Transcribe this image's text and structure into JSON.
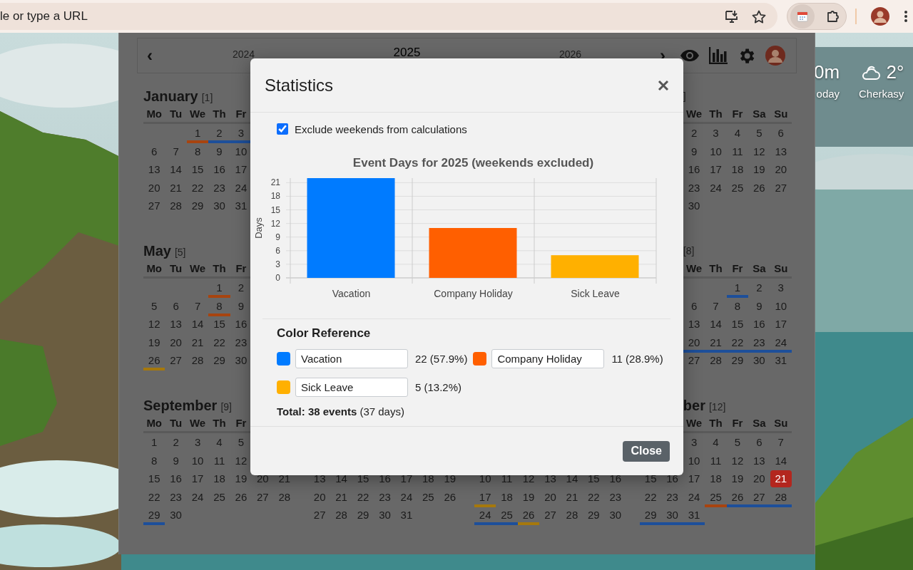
{
  "browser": {
    "address_placeholder": "le or type a URL"
  },
  "weather": {
    "time_fragment": "0m",
    "time_caption": "oday",
    "temperature": "2°",
    "city": "Cherkasy"
  },
  "calendar": {
    "prev": "‹",
    "next": "›",
    "years": [
      {
        "label": "2024",
        "selected": false
      },
      {
        "label": "2025",
        "selected": true
      },
      {
        "label": "2026",
        "selected": false
      }
    ],
    "month_rows": [
      [
        {
          "name": "January",
          "number": "[1]",
          "weekdays": [
            "Mo",
            "Tu",
            "We",
            "Th",
            "Fr"
          ],
          "weeks": [
            [
              {
                "kind": "blank"
              },
              {
                "kind": "blank"
              },
              {
                "kind": "event",
                "day": "1",
                "color": "#a8440f"
              },
              {
                "kind": "event",
                "day": "2",
                "color": "#1d4f9a"
              },
              {
                "kind": "event",
                "day": "3",
                "color": "#1d4f9a"
              }
            ],
            [
              "6",
              "7",
              "8",
              "9",
              "10"
            ],
            [
              "13",
              "14",
              "15",
              "16",
              "17"
            ],
            [
              "20",
              "21",
              "22",
              "23",
              "24"
            ],
            [
              "27",
              "28",
              "29",
              "30",
              "31"
            ]
          ]
        },
        {
          "number": "]",
          "weekdays": [
            {
              "kind": "blank"
            },
            {
              "kind": "blank"
            },
            "We",
            "Th",
            "Fr",
            "Sa",
            "Su"
          ],
          "weeks": [
            [
              {
                "kind": "blank"
              },
              {
                "kind": "blank"
              },
              "2",
              "3",
              "4",
              "5",
              "6"
            ],
            [
              {
                "kind": "blank"
              },
              {
                "kind": "blank"
              },
              "9",
              "10",
              "11",
              "12",
              "13"
            ],
            [
              {
                "kind": "blank"
              },
              {
                "kind": "blank"
              },
              "16",
              "17",
              "18",
              "19",
              "20"
            ],
            [
              {
                "kind": "blank"
              },
              {
                "kind": "blank"
              },
              "23",
              "24",
              "25",
              "26",
              "27"
            ],
            [
              {
                "kind": "blank"
              },
              {
                "kind": "blank"
              },
              "30"
            ]
          ]
        }
      ],
      [
        {
          "name": "May",
          "number": "[5]",
          "weekdays": [
            "Mo",
            "Tu",
            "We",
            "Th",
            "Fr"
          ],
          "weeks": [
            [
              {
                "kind": "blank"
              },
              {
                "kind": "blank"
              },
              {
                "kind": "blank"
              },
              {
                "kind": "event",
                "day": "1",
                "color": "#a8440f"
              },
              "2"
            ],
            [
              "5",
              "6",
              "7",
              {
                "kind": "event",
                "day": "8",
                "color": "#a8440f"
              },
              "9"
            ],
            [
              "12",
              "13",
              "14",
              "15",
              "16"
            ],
            [
              "19",
              "20",
              "21",
              "22",
              "23"
            ],
            [
              {
                "kind": "event",
                "day": "26",
                "color": "#a6780c"
              },
              "27",
              "28",
              "29",
              "30"
            ]
          ]
        },
        {
          "number": "[8]",
          "weekdays": [
            {
              "kind": "blank"
            },
            {
              "kind": "blank"
            },
            "We",
            "Th",
            "Fr",
            "Sa",
            "Su"
          ],
          "weeks": [
            [
              {
                "kind": "blank"
              },
              {
                "kind": "blank"
              },
              {
                "kind": "blank"
              },
              {
                "kind": "blank"
              },
              {
                "kind": "event",
                "day": "1",
                "color": "#1d4f9a"
              },
              "2",
              "3"
            ],
            [
              {
                "kind": "blank"
              },
              {
                "kind": "blank"
              },
              "6",
              "7",
              "8",
              "9",
              "10"
            ],
            [
              {
                "kind": "blank"
              },
              {
                "kind": "blank"
              },
              "13",
              "14",
              "15",
              "16",
              "17"
            ],
            [
              {
                "kind": "blank"
              },
              {
                "kind": "blank"
              },
              {
                "kind": "event",
                "day": "20",
                "color": "#1d4f9a"
              },
              {
                "kind": "event",
                "day": "21",
                "color": "#1d4f9a"
              },
              {
                "kind": "event",
                "day": "22",
                "color": "#1d4f9a"
              },
              {
                "kind": "event",
                "day": "23",
                "color": "#1d4f9a"
              },
              {
                "kind": "event",
                "day": "24",
                "color": "#1d4f9a"
              }
            ],
            [
              {
                "kind": "blank"
              },
              {
                "kind": "blank"
              },
              "27",
              "28",
              "29",
              "30",
              "31"
            ]
          ]
        }
      ],
      [
        {
          "name": "September",
          "number": "[9]",
          "weekdays": [
            "Mo",
            "Tu",
            "We",
            "Th",
            "Fr"
          ],
          "weeks": [
            [
              "1",
              "2",
              "3",
              "4",
              "5"
            ],
            [
              "8",
              "9",
              "10",
              "11",
              "12"
            ],
            [
              "15",
              "16",
              "17",
              "18",
              "19",
              "20",
              "21"
            ],
            [
              "22",
              "23",
              "24",
              "25",
              "26",
              "27",
              "28"
            ],
            [
              {
                "kind": "event",
                "day": "29",
                "color": "#1d4f9a"
              },
              "30"
            ]
          ]
        },
        {
          "weeks": [
            [
              "13",
              "14",
              "15",
              "16",
              "17",
              "18",
              "19"
            ],
            [
              "20",
              "21",
              "22",
              "23",
              "24",
              "25",
              "26"
            ],
            [
              "27",
              "28",
              "29",
              "30",
              "31"
            ]
          ]
        },
        {
          "weeks": [
            [
              "10",
              "11",
              "12",
              "13",
              "14",
              "15",
              "16"
            ],
            [
              {
                "kind": "event",
                "day": "17",
                "color": "#a6780c"
              },
              "18",
              "19",
              "20",
              "21",
              "22",
              "23"
            ],
            [
              {
                "kind": "event",
                "day": "24",
                "color": "#1d4f9a"
              },
              {
                "kind": "event",
                "day": "25",
                "color": "#1d4f9a"
              },
              {
                "kind": "event",
                "day": "26",
                "color": "#a6780c"
              },
              "27",
              "28",
              "29",
              "30"
            ]
          ]
        },
        {
          "name": "ber",
          "number": "[12]",
          "weekdays": [
            {
              "kind": "blank"
            },
            {
              "kind": "blank"
            },
            "We",
            "Th",
            "Fr",
            "Sa",
            "Su"
          ],
          "weeks": [
            [
              {
                "kind": "blank"
              },
              {
                "kind": "blank"
              },
              "3",
              "4",
              "5",
              "6",
              "7"
            ],
            [
              {
                "kind": "blank"
              },
              {
                "kind": "blank"
              },
              "10",
              "11",
              "12",
              "13",
              "14"
            ],
            [
              "15",
              "16",
              "17",
              "18",
              "19",
              "20",
              {
                "kind": "today",
                "day": "21"
              }
            ],
            [
              "22",
              "23",
              "24",
              {
                "kind": "event",
                "day": "25",
                "color": "#a8440f"
              },
              {
                "kind": "event",
                "day": "26",
                "color": "#1d4f9a"
              },
              {
                "kind": "event",
                "day": "27",
                "color": "#1d4f9a"
              },
              {
                "kind": "event",
                "day": "28",
                "color": "#1d4f9a"
              }
            ],
            [
              {
                "kind": "event",
                "day": "29",
                "color": "#1d4f9a"
              },
              {
                "kind": "event",
                "day": "30",
                "color": "#1d4f9a"
              },
              {
                "kind": "event",
                "day": "31",
                "color": "#1d4f9a"
              }
            ]
          ]
        }
      ]
    ]
  },
  "dialog": {
    "title": "Statistics",
    "exclude_weekends": {
      "label": "Exclude weekends from calculations",
      "checked": true
    },
    "chart_data": {
      "type": "bar",
      "title": "Event Days for 2025 (weekends excluded)",
      "ylabel": "Days",
      "categories": [
        "Vacation",
        "Company Holiday",
        "Sick Leave"
      ],
      "values": [
        22,
        11,
        5
      ],
      "ylim": [
        0,
        22
      ],
      "yticks": [
        0,
        3,
        6,
        9,
        12,
        15,
        18,
        21
      ],
      "grid": true
    },
    "legend_title": "Color Reference",
    "legend": [
      {
        "color": "#007bff",
        "value": "Vacation",
        "stat": "22 (57.9%)"
      },
      {
        "color": "#ff5f00",
        "value": "Company Holiday",
        "stat": "11 (28.9%)"
      },
      {
        "color": "#ffb000",
        "value": "Sick Leave",
        "stat": "5 (13.2%)"
      }
    ],
    "total": "**Total: 38 events** (37 days)",
    "close_button": "Close"
  }
}
